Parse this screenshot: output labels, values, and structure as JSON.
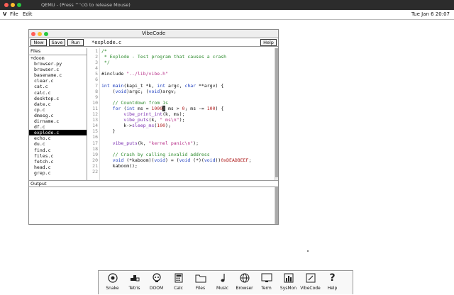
{
  "host": {
    "title": "QEMU - (Press ^⌥G to release Mouse)",
    "lights": [
      "#ff5f57",
      "#febc2e",
      "#28c840"
    ]
  },
  "menubar": {
    "logo": "V",
    "items": [
      "File",
      "Edit"
    ],
    "clock": "Tue Jan 6  20:07"
  },
  "window": {
    "title": "VibeCode",
    "lights": [
      "#ff5f57",
      "#febc2e",
      "#28c840"
    ],
    "buttons": {
      "new": "New",
      "save": "Save",
      "run": "Run",
      "help": "Help"
    },
    "filename": "*explode.c",
    "files_header": "Files",
    "output_header": "Output",
    "files": [
      {
        "name": "+doom",
        "dir": true
      },
      {
        "name": "browser.py"
      },
      {
        "name": "browser.c"
      },
      {
        "name": "basename.c"
      },
      {
        "name": "clear.c"
      },
      {
        "name": "cat.c"
      },
      {
        "name": "calc.c"
      },
      {
        "name": "desktop.c"
      },
      {
        "name": "date.c"
      },
      {
        "name": "cp.c"
      },
      {
        "name": "dmesg.c"
      },
      {
        "name": "dirname.c"
      },
      {
        "name": "df.c"
      },
      {
        "name": "explode.c",
        "selected": true
      },
      {
        "name": "echo.c"
      },
      {
        "name": "du.c"
      },
      {
        "name": "find.c"
      },
      {
        "name": "files.c"
      },
      {
        "name": "fetch.c"
      },
      {
        "name": "head.c"
      },
      {
        "name": "grep.c"
      }
    ],
    "line_numbers": [
      "1",
      "2",
      "3",
      "4",
      "5",
      "6",
      "7",
      "8",
      "9",
      "10",
      "11",
      "12",
      "13",
      "14",
      "15",
      "16",
      "17",
      "18",
      "19",
      "20",
      "21",
      "22"
    ],
    "code_lines": [
      [
        [
          "c-comment",
          "/*"
        ]
      ],
      [
        [
          "c-comment",
          " * Explode - Test program that causes a crash"
        ]
      ],
      [
        [
          "c-comment",
          " */"
        ]
      ],
      [
        [
          "",
          ""
        ]
      ],
      [
        [
          "",
          "#include "
        ],
        [
          "c-str",
          "\"../lib/vibe.h\""
        ]
      ],
      [
        [
          "",
          ""
        ]
      ],
      [
        [
          "c-kw",
          "int"
        ],
        [
          "",
          " "
        ],
        [
          "c-id",
          "main"
        ],
        [
          "",
          "(kapi_t *k, "
        ],
        [
          "c-kw",
          "int"
        ],
        [
          "",
          " argc, "
        ],
        [
          "c-kw",
          "char"
        ],
        [
          "",
          " **argv) {"
        ]
      ],
      [
        [
          "",
          "    ("
        ],
        [
          "c-kw",
          "void"
        ],
        [
          "",
          ")argc; ("
        ],
        [
          "c-kw",
          "void"
        ],
        [
          "",
          ")argv;"
        ]
      ],
      [
        [
          "",
          ""
        ]
      ],
      [
        [
          "c-comment",
          "    // Countdown from 1s"
        ]
      ],
      [
        [
          "",
          "    "
        ],
        [
          "c-kw",
          "for"
        ],
        [
          "",
          " ("
        ],
        [
          "c-kw",
          "int"
        ],
        [
          "",
          " ms = "
        ],
        [
          "c-num",
          "1000"
        ],
        [
          "cursor",
          "|"
        ],
        [
          "",
          " ms > "
        ],
        [
          "c-num",
          "0"
        ],
        [
          "",
          "; ms -= "
        ],
        [
          "c-num",
          "100"
        ],
        [
          "",
          ") {"
        ]
      ],
      [
        [
          "",
          "        "
        ],
        [
          "c-fn",
          "vibe_print_int"
        ],
        [
          "",
          "(k, ms);"
        ]
      ],
      [
        [
          "",
          "        "
        ],
        [
          "c-fn",
          "vibe_puts"
        ],
        [
          "",
          "(k, "
        ],
        [
          "c-str",
          "\" ms\\n\""
        ],
        [
          "",
          ");"
        ]
      ],
      [
        [
          "",
          "        k->"
        ],
        [
          "c-fn",
          "sleep_ms"
        ],
        [
          "",
          "("
        ],
        [
          "c-num",
          "100"
        ],
        [
          "",
          ");"
        ]
      ],
      [
        [
          "",
          "    }"
        ]
      ],
      [
        [
          "",
          ""
        ]
      ],
      [
        [
          "",
          "    "
        ],
        [
          "c-fn",
          "vibe_puts"
        ],
        [
          "",
          "(k, "
        ],
        [
          "c-str",
          "\"kernel panic\\n\""
        ],
        [
          "",
          ");"
        ]
      ],
      [
        [
          "",
          ""
        ]
      ],
      [
        [
          "c-comment",
          "    // Crash by calling invalid address"
        ]
      ],
      [
        [
          "",
          "    "
        ],
        [
          "c-kw",
          "void"
        ],
        [
          "",
          " (*kaboom)("
        ],
        [
          "c-kw",
          "void"
        ],
        [
          "",
          ") = ("
        ],
        [
          "c-kw",
          "void"
        ],
        [
          "",
          " (*)("
        ],
        [
          "c-kw",
          "void"
        ],
        [
          "",
          "))"
        ],
        [
          "c-num",
          "0xDEADBEEF"
        ],
        [
          "",
          ";"
        ]
      ],
      [
        [
          "",
          "    kaboom();"
        ]
      ],
      [
        [
          "",
          ""
        ]
      ]
    ]
  },
  "dock": [
    {
      "label": "Snake",
      "icon": "snake-icon"
    },
    {
      "label": "Tetris",
      "icon": "tetris-icon"
    },
    {
      "label": "DOOM",
      "icon": "doom-icon"
    },
    {
      "label": "Calc",
      "icon": "calculator-icon"
    },
    {
      "label": "Files",
      "icon": "folder-icon"
    },
    {
      "label": "Music",
      "icon": "music-note-icon"
    },
    {
      "label": "Browser",
      "icon": "globe-icon"
    },
    {
      "label": "Term",
      "icon": "terminal-icon"
    },
    {
      "label": "SysMon",
      "icon": "chart-icon"
    },
    {
      "label": "VibeCode",
      "icon": "vibecode-icon"
    },
    {
      "label": "Help",
      "icon": "help-icon"
    }
  ]
}
